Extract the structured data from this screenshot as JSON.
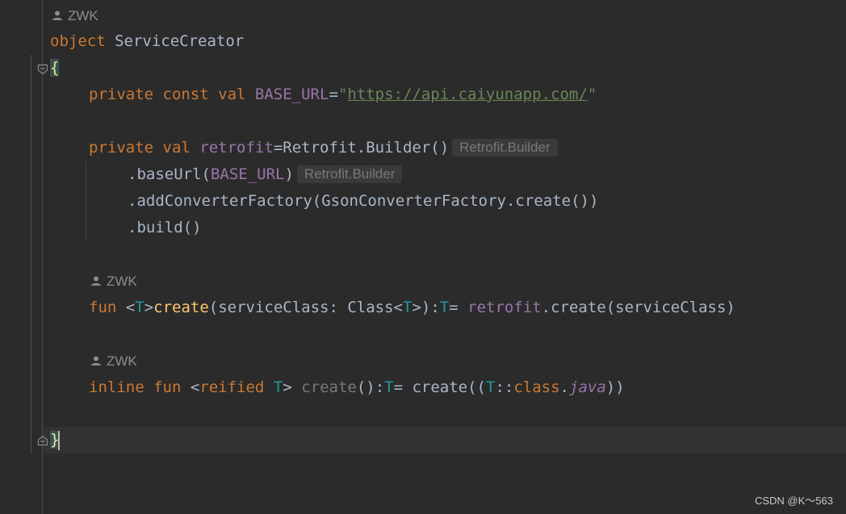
{
  "editor": {
    "authors": [
      {
        "name": "ZWK"
      },
      {
        "name": "ZWK"
      },
      {
        "name": "ZWK"
      }
    ],
    "code": {
      "l1": {
        "kw": "object",
        "name": "ServiceCreator"
      },
      "l2": {
        "brace": "{"
      },
      "l3": {
        "kw": "private const val",
        "prop": "BASE_URL",
        "eq": "=",
        "q1": "\"",
        "url": "https://api.caiyunapp.com/",
        "q2": "\""
      },
      "l4": {
        "kw": "private val",
        "prop": "retrofit",
        "rest": "=Retrofit.Builder()",
        "hint": "Retrofit.Builder"
      },
      "l5": {
        "a": ".baseUrl(",
        "prop": "BASE_URL",
        "b": ")",
        "hint": "Retrofit.Builder"
      },
      "l6": {
        "text": ".addConverterFactory(GsonConverterFactory.create())"
      },
      "l7": {
        "text": ".build()"
      },
      "l8": {
        "kw": "fun",
        "lt": "<",
        "t": "T",
        "gt": ">",
        "fn": "create",
        "a": "(serviceClass: Class<",
        "t2": "T",
        "b": ">):",
        "t3": "T",
        "c": "= ",
        "prop": "retrofit",
        "d": ".create(serviceClass)"
      },
      "l9": {
        "kw": "inline fun",
        "lt": "<",
        "kw2": "reified",
        "t": "T",
        "gt": ">",
        "fn": "create",
        "a": "():",
        "t2": "T",
        "b": "= create((",
        "t3": "T",
        "c": "::",
        "kw3": "class",
        "dot": ".",
        "java": "java",
        "d": "))"
      },
      "l10": {
        "brace": "}"
      }
    }
  },
  "watermark": "CSDN @K～563"
}
